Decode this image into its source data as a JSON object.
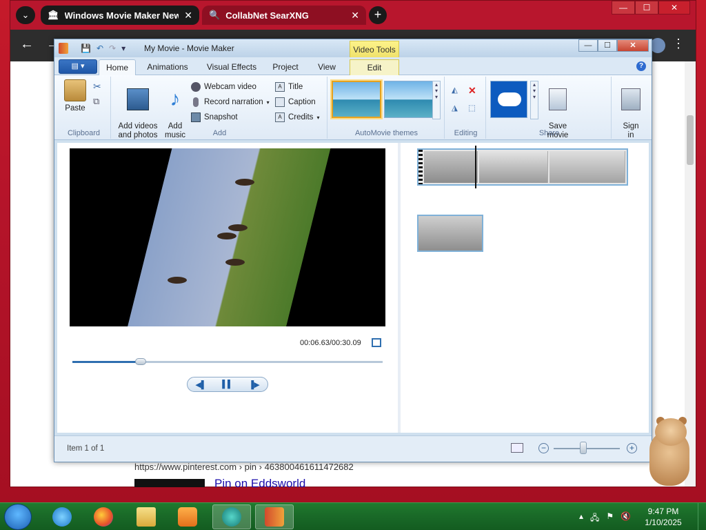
{
  "browser": {
    "tabs": [
      {
        "title": "Windows Movie Maker New ar",
        "active": true
      },
      {
        "title": "CollabNet SearXNG",
        "active": false
      }
    ],
    "page": {
      "url_fragment": "https://www.pinterest.com › pin › 463800461611472682",
      "link_text": "Pin on Eddsworld"
    }
  },
  "moviemaker": {
    "window_title": "My Movie - Movie Maker",
    "context_tab_header": "Video Tools",
    "tabs": [
      {
        "label": "Home",
        "active": true
      },
      {
        "label": "Animations"
      },
      {
        "label": "Visual Effects"
      },
      {
        "label": "Project"
      },
      {
        "label": "View"
      },
      {
        "label": "Edit",
        "contextual": true
      }
    ],
    "ribbon": {
      "clipboard": {
        "label": "Clipboard",
        "paste": "Paste"
      },
      "add": {
        "label": "Add",
        "add_videos": "Add videos\nand photos",
        "add_music": "Add\nmusic",
        "webcam": "Webcam video",
        "record": "Record narration",
        "snapshot": "Snapshot",
        "title": "Title",
        "caption": "Caption",
        "credits": "Credits"
      },
      "themes": {
        "label": "AutoMovie themes"
      },
      "editing": {
        "label": "Editing"
      },
      "share": {
        "label": "Share",
        "save_movie": "Save\nmovie",
        "sign_in": "Sign\nin"
      }
    },
    "preview": {
      "timecode": "00:06.63/00:30.09",
      "progress": 0.22
    },
    "status": {
      "item_text": "Item 1 of 1",
      "zoom_level": 0.45
    }
  },
  "taskbar": {
    "clock_time": "9:47 PM",
    "clock_date": "1/10/2025"
  },
  "colors": {
    "desktop": "#b5142a",
    "taskbar": "#1a6a28",
    "ribbon_accent": "#2f6fb0",
    "context_tab": "#fdf38a"
  }
}
